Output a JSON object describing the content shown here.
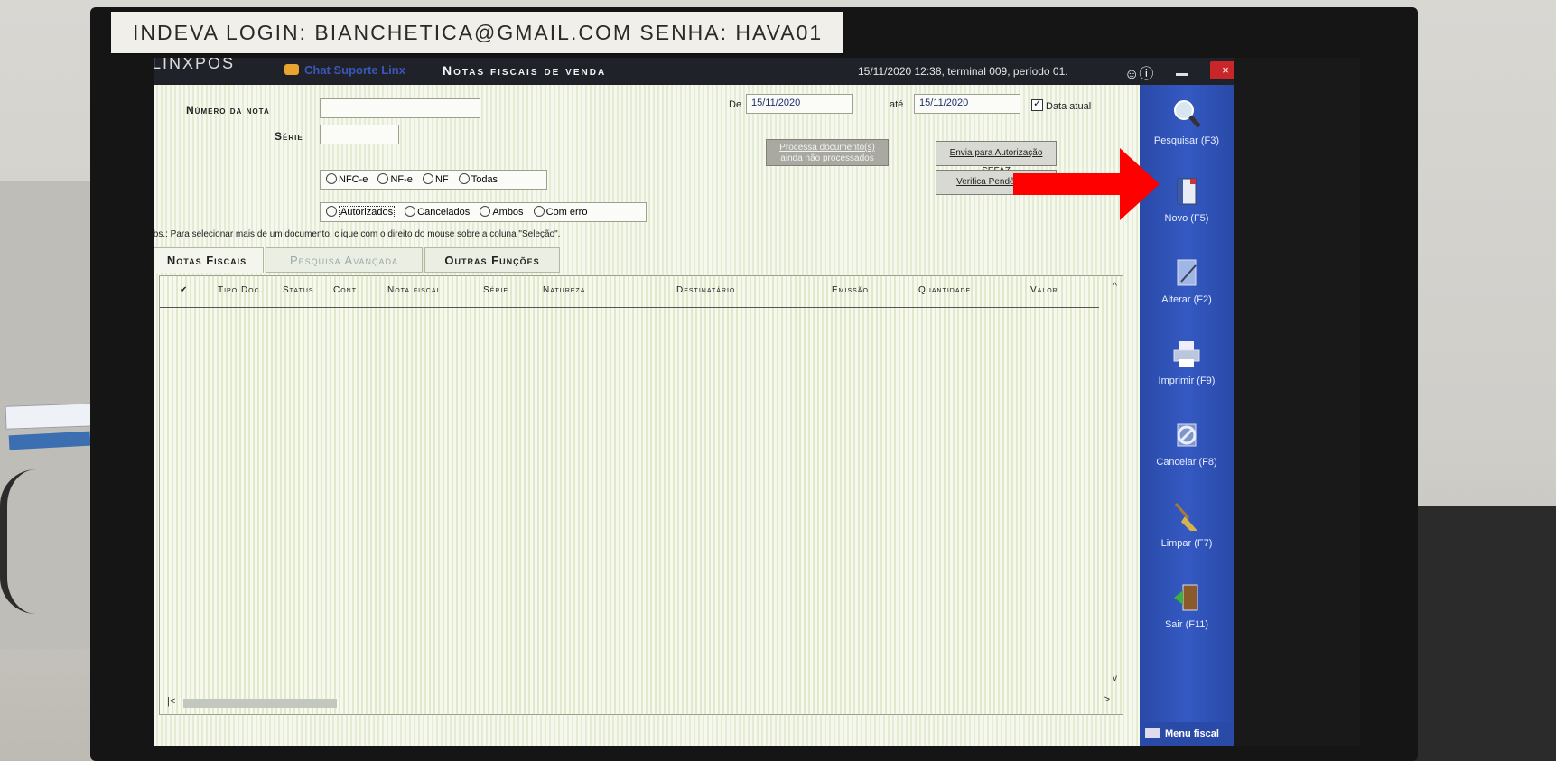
{
  "sticker": {
    "text": "INDEVA LOGIN: BIANCHETICA@GMAIL.COM SENHA: HAVA01"
  },
  "titlebar": {
    "brand": "LINXPOS",
    "chat": "Chat Suporte Linx",
    "title": "Notas fiscais de venda",
    "status": "15/11/2020 12:38, terminal 009, período 01.",
    "icons": "☺ⓘ",
    "close": "×"
  },
  "form": {
    "numero_label": "Número da nota",
    "numero_value": "",
    "serie_label": "Série",
    "serie_value": "",
    "de_label": "De",
    "de_value": "15/11/2020",
    "ate_label": "até",
    "ate_value": "15/11/2020",
    "data_atual_label": "Data atual",
    "doc_types": [
      "NFC-e",
      "NF-e",
      "NF",
      "Todas"
    ],
    "status_types": [
      "Autorizados",
      "Cancelados",
      "Ambos",
      "Com erro"
    ],
    "obs": "Obs.: Para selecionar mais de um documento, clique com o direito do mouse sobre a coluna \"Seleção\".",
    "btn_processa": "Processa documento(s) ainda não processados",
    "btn_envia": "Envia para Autorização SEFAZ",
    "btn_verifica": "Verifica Pendências"
  },
  "tabs": [
    "Notas Fiscais",
    "Pesquisa Avançada",
    "Outras Funções"
  ],
  "grid": {
    "columns": [
      "✔",
      "Tipo Doc.",
      "Status",
      "Cont.",
      "Nota fiscal",
      "Série",
      "Natureza",
      "Destinatário",
      "Emissão",
      "Quantidade",
      "Valor"
    ],
    "rows": [],
    "scroll_up": "^",
    "scroll_down": "v",
    "scroll_left": "|<",
    "scroll_right": ">"
  },
  "sidebar": {
    "items": [
      {
        "label": "Pesquisar (F3)",
        "icon": "magnifier-icon"
      },
      {
        "label": "Novo (F5)",
        "icon": "new-document-icon"
      },
      {
        "label": "Alterar (F2)",
        "icon": "edit-document-icon"
      },
      {
        "label": "Imprimir (F9)",
        "icon": "printer-icon"
      },
      {
        "label": "Cancelar (F8)",
        "icon": "cancel-icon"
      },
      {
        "label": "Limpar (F7)",
        "icon": "broom-icon"
      },
      {
        "label": "Sair (F11)",
        "icon": "exit-door-icon"
      }
    ],
    "menu_fiscal": "Menu fiscal"
  },
  "colors": {
    "sidebar": "#2a4aa8",
    "titlebar": "#1f2228",
    "close_button": "#c9262a",
    "annotation_arrow": "#ff0000"
  }
}
